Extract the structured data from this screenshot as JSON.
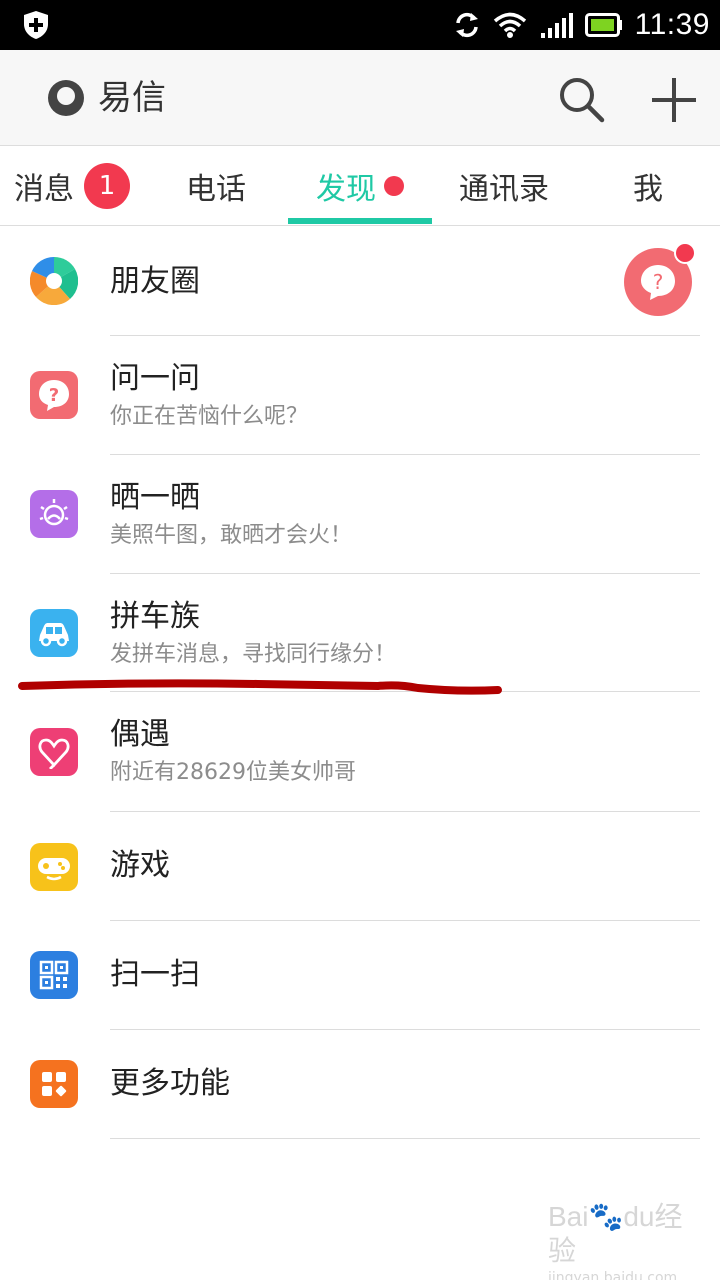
{
  "status_bar": {
    "time": "11:39",
    "icons": [
      "shield-icon",
      "sync-icon",
      "wifi-icon",
      "signal-icon",
      "battery-icon"
    ]
  },
  "app_bar": {
    "title": "易信",
    "icons": [
      "app-logo-icon",
      "search-icon",
      "add-icon"
    ]
  },
  "tabs": [
    {
      "label": "消息",
      "badge": "1"
    },
    {
      "label": "电话"
    },
    {
      "label": "发现",
      "active": true,
      "dot": true
    },
    {
      "label": "通讯录"
    },
    {
      "label": "我"
    }
  ],
  "items": [
    {
      "title": "朋友圈",
      "subtitle": "",
      "icon": "moments-icon",
      "color": "#2f8ee8"
    },
    {
      "title": "问一问",
      "subtitle": "你正在苦恼什么呢？",
      "icon": "question-icon",
      "color": "#f26b72"
    },
    {
      "title": "晒一晒",
      "subtitle": "美照牛图，敢晒才会火！",
      "icon": "sun-photo-icon",
      "color": "#b46ee8"
    },
    {
      "title": "拼车族",
      "subtitle": "发拼车消息，寻找同行缘分！",
      "icon": "car-icon",
      "color": "#3ab2ef"
    },
    {
      "title": "偶遇",
      "subtitle": "附近有28629位美女帅哥",
      "icon": "heart-icon",
      "color": "#ee3f75"
    },
    {
      "title": "游戏",
      "subtitle": "",
      "icon": "gamepad-icon",
      "color": "#f7c21a"
    },
    {
      "title": "扫一扫",
      "subtitle": "",
      "icon": "qr-scan-icon",
      "color": "#2c7fe0"
    },
    {
      "title": "更多功能",
      "subtitle": "",
      "icon": "more-apps-icon",
      "color": "#f5721f"
    }
  ],
  "floating_button": {
    "icon": "question-bubble-icon",
    "color": "#f26b72"
  },
  "colors": {
    "accent": "#1fc9a5",
    "badge": "#f2394f",
    "annotation": "#b00000"
  },
  "watermark": {
    "brand": "Bai",
    "brand2": "du",
    "text": "经验",
    "url": "jingyan.baidu.com"
  }
}
